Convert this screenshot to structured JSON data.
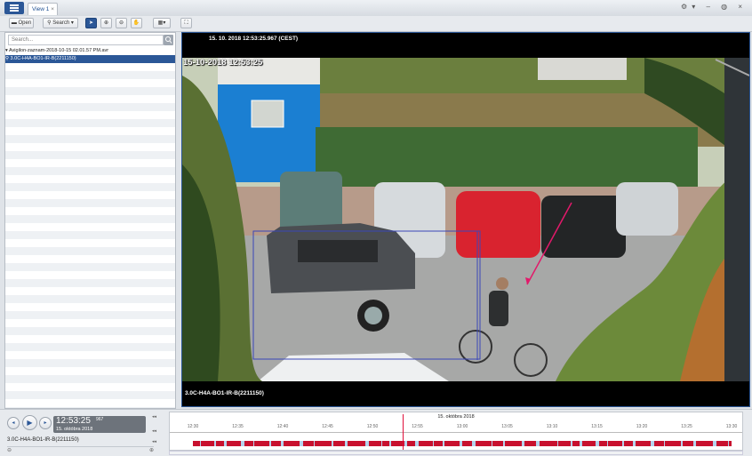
{
  "header": {
    "tab_label": "View 1",
    "tab_close": "×",
    "window_controls": "⚙▾ – ◍ ×"
  },
  "toolbar": {
    "open_label": "Open",
    "search_label": "Search ▾"
  },
  "left_panel": {
    "search_placeholder": "Search...",
    "tree": [
      {
        "label": "▾  Avigilon-zaznam-2018-10-15 02.01.57 PM.avr"
      },
      {
        "label": "    ⚲  3.0C-H4A-BO1-IR-B(2211150)"
      }
    ]
  },
  "video": {
    "top_timestamp": "15. 10. 2018 12:53:25.967 (CEST)",
    "osd_timestamp": "15-10-2018 12:53:25",
    "camera_label": "3.0C-H4A-BO1-IR-B(2211150)"
  },
  "playback": {
    "time": "12:53:25",
    "ms": "967",
    "date": "15. októbra 2018",
    "camera_label": "3.0C-H4A-BO1-IR-B(2211150)",
    "zoom_left": "⊖",
    "zoom_right": "⊕"
  },
  "timeline": {
    "date_label": "15. októbra 2018",
    "tick_labels": [
      "12:30",
      "12:35",
      "12:40",
      "12:45",
      "12:50",
      "12:55",
      "13:00",
      "13:05",
      "13:10",
      "13:15",
      "13:20",
      "13:25",
      "13:30"
    ],
    "playhead_time": "12:53:25"
  },
  "colors": {
    "accent": "#2b5797",
    "recording": "#c8102e",
    "no_recording": "#b5d2ec"
  }
}
